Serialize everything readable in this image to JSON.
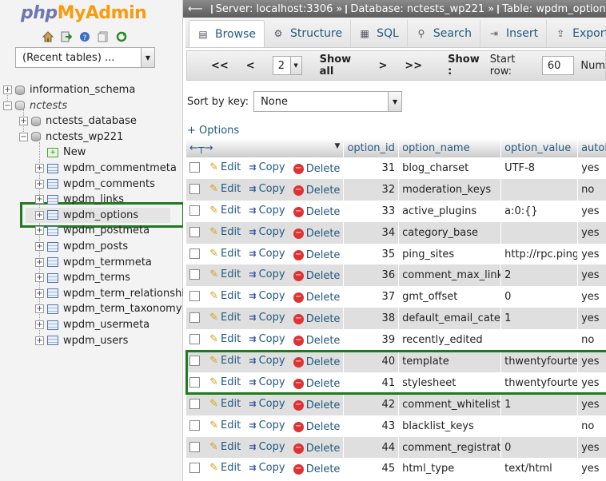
{
  "app": {
    "logo_php": "php",
    "logo_my": "My",
    "logo_admin": "Admin"
  },
  "nav": {
    "quick_icons": [
      "home-icon",
      "logout-icon",
      "help-icon",
      "docs-icon",
      "reload-icon"
    ],
    "recent_tables": "(Recent tables) ...",
    "tree": [
      {
        "label": "information_schema",
        "level": 0,
        "type": "db"
      },
      {
        "label": "nctests",
        "level": 0,
        "type": "group"
      },
      {
        "label": "nctests_database",
        "level": 1,
        "type": "db"
      },
      {
        "label": "nctests_wp221",
        "level": 1,
        "type": "db"
      },
      {
        "label": "New",
        "level": 2,
        "type": "new"
      },
      {
        "label": "wpdm_commentmeta",
        "level": 2,
        "type": "table"
      },
      {
        "label": "wpdm_comments",
        "level": 2,
        "type": "table"
      },
      {
        "label": "wpdm_links",
        "level": 2,
        "type": "table"
      },
      {
        "label": "wpdm_options",
        "level": 2,
        "type": "table",
        "selected": true
      },
      {
        "label": "wpdm_postmeta",
        "level": 2,
        "type": "table"
      },
      {
        "label": "wpdm_posts",
        "level": 2,
        "type": "table"
      },
      {
        "label": "wpdm_termmeta",
        "level": 2,
        "type": "table"
      },
      {
        "label": "wpdm_terms",
        "level": 2,
        "type": "table"
      },
      {
        "label": "wpdm_term_relationships",
        "level": 2,
        "type": "table"
      },
      {
        "label": "wpdm_term_taxonomy",
        "level": 2,
        "type": "table"
      },
      {
        "label": "wpdm_usermeta",
        "level": 2,
        "type": "table"
      },
      {
        "label": "wpdm_users",
        "level": 2,
        "type": "table"
      }
    ]
  },
  "breadcrumb": {
    "server": "Server: localhost:3306",
    "database": "Database: nctests_wp221",
    "table": "Table: wpdm_options"
  },
  "tabs": [
    {
      "label": "Browse",
      "icon": "browse-icon",
      "active": true
    },
    {
      "label": "Structure",
      "icon": "structure-icon"
    },
    {
      "label": "SQL",
      "icon": "sql-icon"
    },
    {
      "label": "Search",
      "icon": "search-icon"
    },
    {
      "label": "Insert",
      "icon": "insert-icon"
    },
    {
      "label": "Export",
      "icon": "export-icon"
    }
  ],
  "pager": {
    "first": "<<",
    "prev": "<",
    "page": "2",
    "show_all": "Show all",
    "next": ">",
    "last": ">>",
    "show": "Show :",
    "start_row_label": "Start row:",
    "start_row_value": "60",
    "num_label": "Num"
  },
  "sort": {
    "label": "Sort by key:",
    "value": "None"
  },
  "options_link": "+ Options",
  "columns": [
    "option_id",
    "option_name",
    "option_value",
    "autoload"
  ],
  "actions": {
    "edit": "Edit",
    "copy": "Copy",
    "delete": "Delete"
  },
  "rows": [
    {
      "id": "31",
      "name": "blog_charset",
      "value": "UTF-8",
      "autoload": "yes"
    },
    {
      "id": "32",
      "name": "moderation_keys",
      "value": "",
      "autoload": "no"
    },
    {
      "id": "33",
      "name": "active_plugins",
      "value": "a:0:{}",
      "autoload": "yes"
    },
    {
      "id": "34",
      "name": "category_base",
      "value": "",
      "autoload": "yes"
    },
    {
      "id": "35",
      "name": "ping_sites",
      "value": "http://rpc.pingomatic.com/",
      "autoload": "yes"
    },
    {
      "id": "36",
      "name": "comment_max_links",
      "value": "2",
      "autoload": "yes"
    },
    {
      "id": "37",
      "name": "gmt_offset",
      "value": "0",
      "autoload": "yes"
    },
    {
      "id": "38",
      "name": "default_email_category",
      "value": "1",
      "autoload": "yes"
    },
    {
      "id": "39",
      "name": "recently_edited",
      "value": "",
      "autoload": "no"
    },
    {
      "id": "40",
      "name": "template",
      "value": "thwentyfourteen",
      "autoload": "yes"
    },
    {
      "id": "41",
      "name": "stylesheet",
      "value": "thwentyfourteen",
      "autoload": "yes"
    },
    {
      "id": "42",
      "name": "comment_whitelist",
      "value": "1",
      "autoload": "yes"
    },
    {
      "id": "43",
      "name": "blacklist_keys",
      "value": "",
      "autoload": "no"
    },
    {
      "id": "44",
      "name": "comment_registration",
      "value": "0",
      "autoload": "yes"
    },
    {
      "id": "45",
      "name": "html_type",
      "value": "text/html",
      "autoload": "yes"
    }
  ],
  "colors": {
    "highlight": "#1e7a1e",
    "link": "#235a81"
  }
}
